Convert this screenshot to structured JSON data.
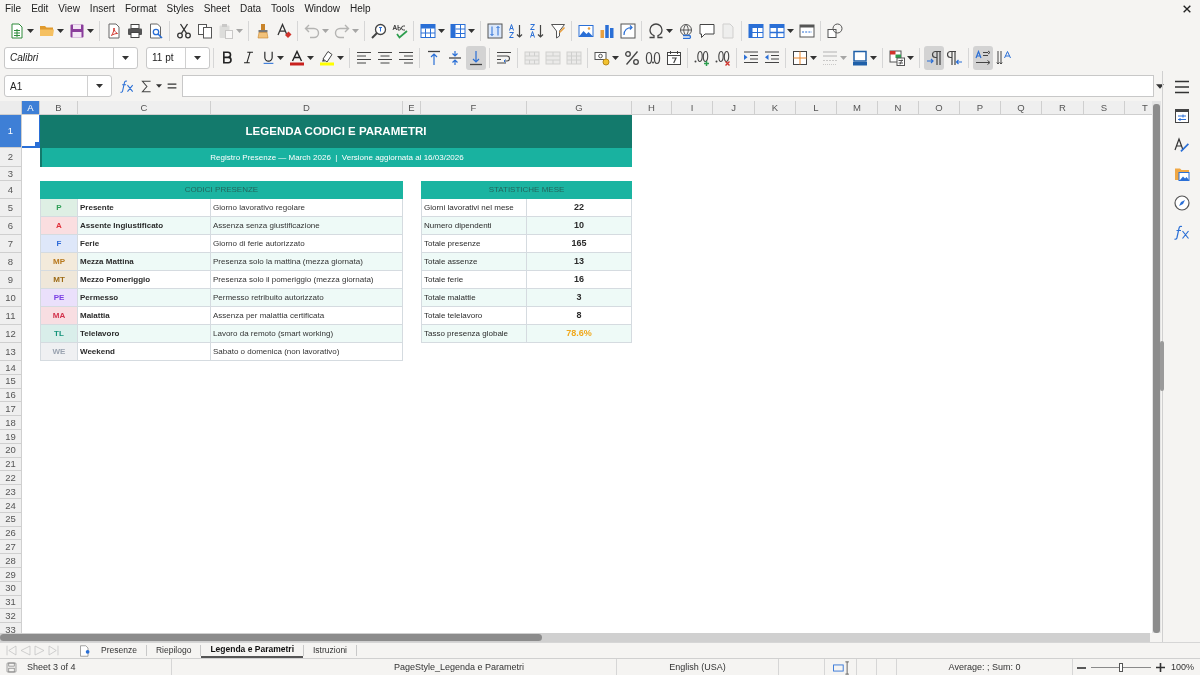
{
  "menu": [
    "File",
    "Edit",
    "View",
    "Insert",
    "Format",
    "Styles",
    "Sheet",
    "Data",
    "Tools",
    "Window",
    "Help"
  ],
  "toolbar_1": {
    "groups": [
      [
        {
          "kind": "new_sheet",
          "dropdown": true,
          "disabled": false
        },
        {
          "kind": "open",
          "dropdown": true,
          "disabled": false
        },
        {
          "kind": "save",
          "dropdown": true,
          "disabled": false
        }
      ],
      [
        {
          "kind": "export_pdf",
          "dropdown": false,
          "disabled": false
        },
        {
          "kind": "print",
          "dropdown": false,
          "disabled": false
        },
        {
          "kind": "print_preview",
          "dropdown": false,
          "disabled": false
        }
      ],
      [
        {
          "kind": "cut",
          "dropdown": false,
          "disabled": false
        },
        {
          "kind": "copy",
          "dropdown": false,
          "disabled": false
        },
        {
          "kind": "paste",
          "dropdown": true,
          "disabled": true
        }
      ],
      [
        {
          "kind": "clone_formatting",
          "dropdown": false,
          "disabled": false
        },
        {
          "kind": "clear_formatting",
          "dropdown": false,
          "disabled": false
        }
      ],
      [
        {
          "kind": "undo",
          "dropdown": true,
          "disabled": true
        },
        {
          "kind": "redo",
          "dropdown": true,
          "disabled": true
        }
      ],
      [
        {
          "kind": "find_replace",
          "dropdown": false,
          "disabled": false
        },
        {
          "kind": "spelling",
          "dropdown": false,
          "disabled": false
        }
      ],
      [
        {
          "kind": "rows",
          "dropdown": true,
          "disabled": false
        },
        {
          "kind": "columns",
          "dropdown": true,
          "disabled": false
        }
      ],
      [
        {
          "kind": "sort",
          "dropdown": false,
          "disabled": false
        },
        {
          "kind": "sort_ascending",
          "dropdown": false,
          "disabled": false
        },
        {
          "kind": "sort_descending",
          "dropdown": false,
          "disabled": false
        },
        {
          "kind": "autofilter",
          "dropdown": false,
          "disabled": false
        }
      ],
      [
        {
          "kind": "image",
          "dropdown": false,
          "disabled": false
        },
        {
          "kind": "chart",
          "dropdown": false,
          "disabled": false
        },
        {
          "kind": "pivot_table",
          "dropdown": false,
          "disabled": false
        }
      ],
      [
        {
          "kind": "special_character",
          "dropdown": true,
          "disabled": false
        },
        {
          "kind": "hyperlink",
          "dropdown": false,
          "disabled": false
        },
        {
          "kind": "comment",
          "dropdown": false,
          "disabled": false
        },
        {
          "kind": "header_footer",
          "dropdown": false,
          "disabled": true
        }
      ],
      [
        {
          "kind": "freeze",
          "dropdown": false,
          "disabled": false
        },
        {
          "kind": "split",
          "dropdown": true,
          "disabled": false
        },
        {
          "kind": "headers",
          "dropdown": false,
          "disabled": false
        }
      ],
      [
        {
          "kind": "shapes",
          "dropdown": false,
          "disabled": false
        }
      ]
    ]
  },
  "toolbar_2": {
    "font_name": "Calibri",
    "font_size": "11 pt",
    "groups": [
      [
        {
          "kind": "bold",
          "dropdown": false,
          "disabled": false,
          "pressed": false
        },
        {
          "kind": "italic",
          "dropdown": false,
          "disabled": false,
          "pressed": false
        },
        {
          "kind": "underline",
          "dropdown": true,
          "disabled": false,
          "pressed": false
        },
        {
          "kind": "font_color",
          "dropdown": true,
          "disabled": false,
          "pressed": false
        },
        {
          "kind": "highlight",
          "dropdown": true,
          "disabled": false,
          "pressed": false
        }
      ],
      [
        {
          "kind": "align_left",
          "dropdown": false,
          "disabled": false,
          "pressed": false
        },
        {
          "kind": "align_center",
          "dropdown": false,
          "disabled": false,
          "pressed": false
        },
        {
          "kind": "align_right",
          "dropdown": false,
          "disabled": false,
          "pressed": false
        }
      ],
      [
        {
          "kind": "align_top",
          "dropdown": false,
          "disabled": false,
          "pressed": false
        },
        {
          "kind": "align_middle",
          "dropdown": false,
          "disabled": false,
          "pressed": false
        },
        {
          "kind": "align_bottom",
          "dropdown": false,
          "disabled": false,
          "pressed": true
        }
      ],
      [
        {
          "kind": "wrap",
          "dropdown": false,
          "disabled": false,
          "pressed": false
        }
      ],
      [
        {
          "kind": "merge_center",
          "dropdown": false,
          "disabled": true,
          "pressed": false
        },
        {
          "kind": "merge",
          "dropdown": false,
          "disabled": true,
          "pressed": false
        },
        {
          "kind": "unmerge",
          "dropdown": false,
          "disabled": true,
          "pressed": false
        }
      ],
      [
        {
          "kind": "currency",
          "dropdown": true,
          "disabled": false,
          "pressed": false
        },
        {
          "kind": "percent",
          "dropdown": false,
          "disabled": false,
          "pressed": false
        },
        {
          "kind": "number",
          "dropdown": false,
          "disabled": false,
          "pressed": false
        },
        {
          "kind": "date",
          "dropdown": false,
          "disabled": false,
          "pressed": false
        }
      ],
      [
        {
          "kind": "add_decimal",
          "dropdown": false,
          "disabled": false,
          "pressed": false
        },
        {
          "kind": "delete_decimal",
          "dropdown": false,
          "disabled": false,
          "pressed": false
        }
      ],
      [
        {
          "kind": "indent_increase",
          "dropdown": false,
          "disabled": false,
          "pressed": false
        },
        {
          "kind": "indent_decrease",
          "dropdown": false,
          "disabled": false,
          "pressed": false
        }
      ],
      [
        {
          "kind": "borders",
          "dropdown": true,
          "disabled": false,
          "pressed": false
        },
        {
          "kind": "border_style",
          "dropdown": true,
          "disabled": true,
          "pressed": false
        },
        {
          "kind": "border_color",
          "dropdown": true,
          "disabled": false,
          "pressed": false
        }
      ],
      [
        {
          "kind": "conditional",
          "dropdown": true,
          "disabled": false,
          "pressed": false
        }
      ],
      [
        {
          "kind": "paragraph_ltr",
          "dropdown": false,
          "disabled": false,
          "pressed": true
        },
        {
          "kind": "paragraph_rtl",
          "dropdown": false,
          "disabled": false,
          "pressed": false
        }
      ],
      [
        {
          "kind": "text_horizontal",
          "dropdown": false,
          "disabled": false,
          "pressed": true
        },
        {
          "kind": "text_vertical",
          "dropdown": false,
          "disabled": false,
          "pressed": false
        }
      ]
    ]
  },
  "formula_bar": {
    "name_box": "A1"
  },
  "sheet": {
    "columns": [
      {
        "label": "A",
        "selected": true
      },
      {
        "label": "B",
        "selected": false
      },
      {
        "label": "C",
        "selected": false
      },
      {
        "label": "D",
        "selected": false
      },
      {
        "label": "E",
        "selected": false
      },
      {
        "label": "F",
        "selected": false
      },
      {
        "label": "G",
        "selected": false
      },
      {
        "label": "H",
        "selected": false
      },
      {
        "label": "I",
        "selected": false
      },
      {
        "label": "J",
        "selected": false
      },
      {
        "label": "K",
        "selected": false
      },
      {
        "label": "L",
        "selected": false
      },
      {
        "label": "M",
        "selected": false
      },
      {
        "label": "N",
        "selected": false
      },
      {
        "label": "O",
        "selected": false
      },
      {
        "label": "P",
        "selected": false
      },
      {
        "label": "Q",
        "selected": false
      },
      {
        "label": "R",
        "selected": false
      },
      {
        "label": "S",
        "selected": false
      },
      {
        "label": "T",
        "selected": false
      }
    ],
    "rows": [
      {
        "label": "1",
        "selected": true
      },
      {
        "label": "2",
        "selected": false
      },
      {
        "label": "3",
        "selected": false
      },
      {
        "label": "4",
        "selected": false
      },
      {
        "label": "5",
        "selected": false
      },
      {
        "label": "6",
        "selected": false
      },
      {
        "label": "7",
        "selected": false
      },
      {
        "label": "8",
        "selected": false
      },
      {
        "label": "9",
        "selected": false
      },
      {
        "label": "10",
        "selected": false
      },
      {
        "label": "11",
        "selected": false
      },
      {
        "label": "12",
        "selected": false
      },
      {
        "label": "13",
        "selected": false
      },
      {
        "label": "14",
        "selected": false
      },
      {
        "label": "15",
        "selected": false
      },
      {
        "label": "16",
        "selected": false
      },
      {
        "label": "17",
        "selected": false
      },
      {
        "label": "18",
        "selected": false
      },
      {
        "label": "19",
        "selected": false
      },
      {
        "label": "20",
        "selected": false
      },
      {
        "label": "21",
        "selected": false
      },
      {
        "label": "22",
        "selected": false
      },
      {
        "label": "23",
        "selected": false
      },
      {
        "label": "24",
        "selected": false
      },
      {
        "label": "25",
        "selected": false
      },
      {
        "label": "26",
        "selected": false
      },
      {
        "label": "27",
        "selected": false
      },
      {
        "label": "28",
        "selected": false
      },
      {
        "label": "29",
        "selected": false
      },
      {
        "label": "30",
        "selected": false
      },
      {
        "label": "31",
        "selected": false
      },
      {
        "label": "32",
        "selected": false
      },
      {
        "label": "33",
        "selected": false
      }
    ],
    "title": "LEGENDA CODICI E PARAMETRI",
    "subtitle": "Registro Presenze — March 2026  |  Versione aggiornata al 16/03/2026",
    "codes": {
      "header": "CODICI PRESENZE",
      "items": [
        {
          "code": "P",
          "color": "#2e9e55",
          "name": "Presente",
          "description": "Giorno lavorativo regolare"
        },
        {
          "code": "A",
          "color": "#e0313b",
          "name": "Assente Ingiustificato",
          "description": "Assenza senza giustificazione"
        },
        {
          "code": "F",
          "color": "#2f6bd8",
          "name": "Ferie",
          "description": "Giorno di ferie autorizzato"
        },
        {
          "code": "MP",
          "color": "#b7791f",
          "name": "Mezza Mattina",
          "description": "Presenza solo la mattina (mezza giornata)"
        },
        {
          "code": "MT",
          "color": "#9c6a14",
          "name": "Mezzo Pomeriggio",
          "description": "Presenza solo il pomeriggio (mezza giornata)"
        },
        {
          "code": "PE",
          "color": "#7b3fe4",
          "name": "Permesso",
          "description": "Permesso retribuito autorizzato"
        },
        {
          "code": "MA",
          "color": "#d2334c",
          "name": "Malattia",
          "description": "Assenza per malattia certificata"
        },
        {
          "code": "TL",
          "color": "#14937a",
          "name": "Telelavoro",
          "description": "Lavoro da remoto (smart working)"
        },
        {
          "code": "WE",
          "color": "#9aa3b0",
          "name": "Weekend",
          "description": "Sabato o domenica (non lavorativo)"
        }
      ]
    },
    "stats": {
      "header": "STATISTICHE MESE",
      "items": [
        {
          "label": "Giorni lavorativi nel mese",
          "value": "22",
          "color": "#2b2b2b"
        },
        {
          "label": "Numero dipendenti",
          "value": "10",
          "color": "#2b2b2b"
        },
        {
          "label": "Totale presenze",
          "value": "165",
          "color": "#2b2b2b"
        },
        {
          "label": "Totale assenze",
          "value": "13",
          "color": "#2b2b2b"
        },
        {
          "label": "Totale ferie",
          "value": "16",
          "color": "#2b2b2b"
        },
        {
          "label": "Totale malattie",
          "value": "3",
          "color": "#2b2b2b"
        },
        {
          "label": "Totale telelavoro",
          "value": "8",
          "color": "#2b2b2b"
        },
        {
          "label": "Tasso presenza globale",
          "value": "78.6%",
          "color": "#f0a81c"
        }
      ]
    }
  },
  "sheet_tabs": [
    {
      "label": "Presenze",
      "selected": false
    },
    {
      "label": "Riepilogo",
      "selected": false
    },
    {
      "label": "Legenda e Parametri",
      "selected": true
    },
    {
      "label": "Istruzioni",
      "selected": false
    }
  ],
  "status_bar": {
    "sheet_position": "Sheet 3 of 4",
    "page_style": "PageStyle_Legenda e Parametri",
    "language": "English (USA)",
    "selection_summary": "Average: ; Sum: 0",
    "zoom": {
      "level": 0.5,
      "reading": "100%"
    }
  }
}
